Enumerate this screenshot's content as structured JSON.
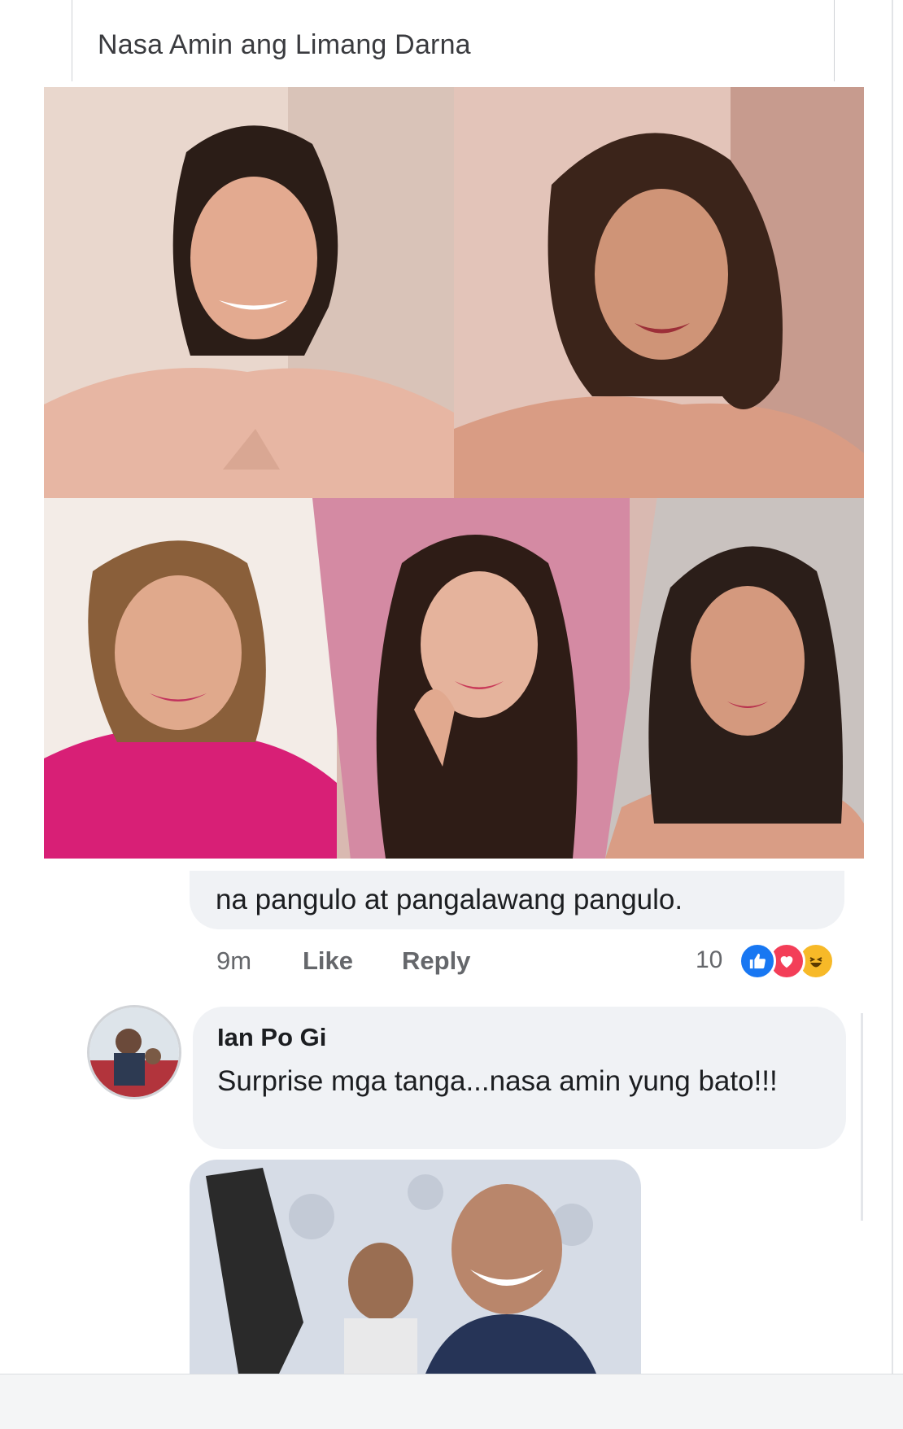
{
  "post": {
    "title": "Nasa Amin ang Limang Darna"
  },
  "comment_previous": {
    "text_tail": "na pangulo at pangalawang pangulo.",
    "time": "9m",
    "like_label": "Like",
    "reply_label": "Reply",
    "reaction_count": "10",
    "reactions": [
      "like-icon",
      "love-icon",
      "haha-icon"
    ]
  },
  "comment_reply": {
    "author": "Ian Po Gi",
    "text": "Surprise mga tanga...nasa amin yung bato!!!"
  },
  "colors": {
    "bubble": "#f0f2f5",
    "meta_text": "#65676b",
    "like_blue": "#1877f2",
    "love_red": "#f33e58",
    "haha_yellow": "#f7b928"
  }
}
